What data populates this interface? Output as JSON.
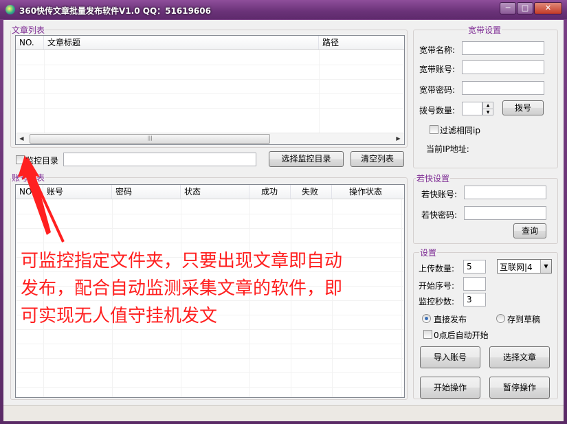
{
  "window": {
    "title": "360快传文章批量发布软件V1.0 QQ：51619606",
    "min_glyph": "─",
    "max_glyph": "□",
    "close_glyph": "✕"
  },
  "article_list": {
    "legend": "文章列表",
    "columns": [
      "NO.",
      "文章标题",
      "路径"
    ],
    "scroll_thumb_glyph": "|||"
  },
  "monitor": {
    "checkbox_label": "监控目录",
    "path_value": "",
    "choose_button": "选择监控目录",
    "clear_button": "清空列表"
  },
  "account_list": {
    "legend": "账号列表",
    "columns": [
      "NO.",
      "账号",
      "密码",
      "状态",
      "成功",
      "失败",
      "操作状态"
    ]
  },
  "broadband": {
    "legend": "宽带设置",
    "name_label": "宽带名称:",
    "name_value": "",
    "account_label": "宽带账号:",
    "account_value": "",
    "password_label": "宽带密码:",
    "password_value": "",
    "dial_count_label": "拨号数量:",
    "dial_count_value": "",
    "dial_button": "拨号",
    "filter_ip_label": "过滤相同ip",
    "current_ip_label": "当前IP地址:"
  },
  "ruokuai": {
    "legend": "若快设置",
    "account_label": "若快账号:",
    "account_value": "",
    "password_label": "若快密码:",
    "password_value": "",
    "query_button": "查询"
  },
  "settings": {
    "legend": "设置",
    "upload_count_label": "上传数量:",
    "upload_count_value": "5",
    "site_selected": "互联网|4",
    "start_index_label": "开始序号:",
    "start_index_value": "",
    "monitor_seconds_label": "监控秒数:",
    "monitor_seconds_value": "3",
    "publish_direct_label": "直接发布",
    "save_draft_label": "存到草稿",
    "auto_start_label": "0点后自动开始",
    "import_accounts_button": "导入账号",
    "select_articles_button": "选择文章",
    "start_button": "开始操作",
    "pause_button": "暂停操作"
  },
  "annotation": {
    "line1": "可监控指定文件夹，只要出现文章即自动",
    "line2": "发布，配合自动监测采集文章的软件，即",
    "line3": "可实现无人值守挂机发文",
    "color": "#ff2020"
  }
}
